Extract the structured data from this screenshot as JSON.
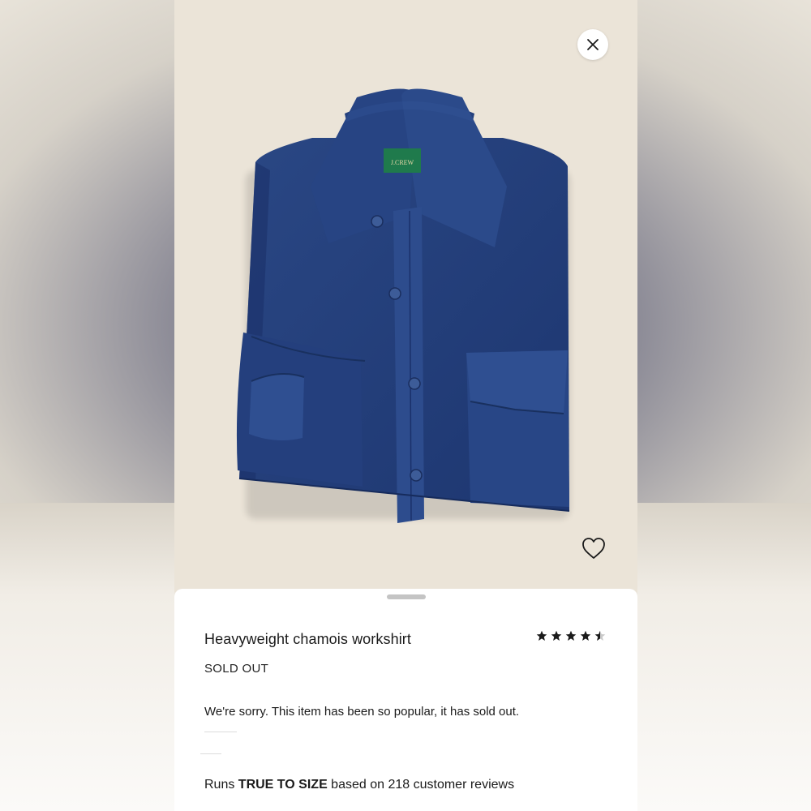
{
  "product": {
    "title": "Heavyweight chamois workshirt",
    "status": "SOLD OUT",
    "message": "We're sorry. This item has been so popular, it has sold out.",
    "rating": 4.5,
    "brand_label": "J.CREW",
    "shirt_color": "#233f79"
  },
  "fit": {
    "prefix": "Runs ",
    "emphasis": "TRUE TO SIZE",
    "suffix": " based on 218 customer reviews"
  },
  "icons": {
    "close": "close-icon",
    "heart": "heart-icon",
    "star": "star-icon"
  },
  "colors": {
    "image_background": "#ebe4d8",
    "sheet_background": "#ffffff",
    "text": "#1b1b1b"
  }
}
